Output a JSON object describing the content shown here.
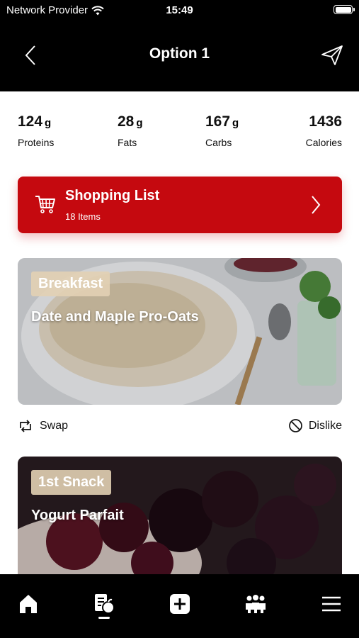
{
  "status_bar": {
    "carrier": "Network Provider",
    "time": "15:49"
  },
  "header": {
    "title": "Option 1"
  },
  "macros": [
    {
      "value": "124",
      "unit": "g",
      "label": "Proteins"
    },
    {
      "value": "28",
      "unit": "g",
      "label": "Fats"
    },
    {
      "value": "167",
      "unit": "g",
      "label": "Carbs"
    },
    {
      "value": "1436",
      "unit": "",
      "label": "Calories"
    }
  ],
  "shopping_list": {
    "title": "Shopping List",
    "subtitle": "18 Items"
  },
  "meals": [
    {
      "tag": "Breakfast",
      "name": "Date and Maple Pro-Oats"
    },
    {
      "tag": "1st Snack",
      "name": "Yogurt Parfait"
    }
  ],
  "actions": {
    "swap": "Swap",
    "dislike": "Dislike"
  },
  "colors": {
    "accent": "#c5090f",
    "tag_bg": "#e2d0b4",
    "bar_bg": "#000000"
  },
  "tabbar": {
    "items": [
      "home-icon",
      "meal-plan-icon",
      "add-icon",
      "community-icon",
      "menu-icon"
    ],
    "active_index": 1
  }
}
